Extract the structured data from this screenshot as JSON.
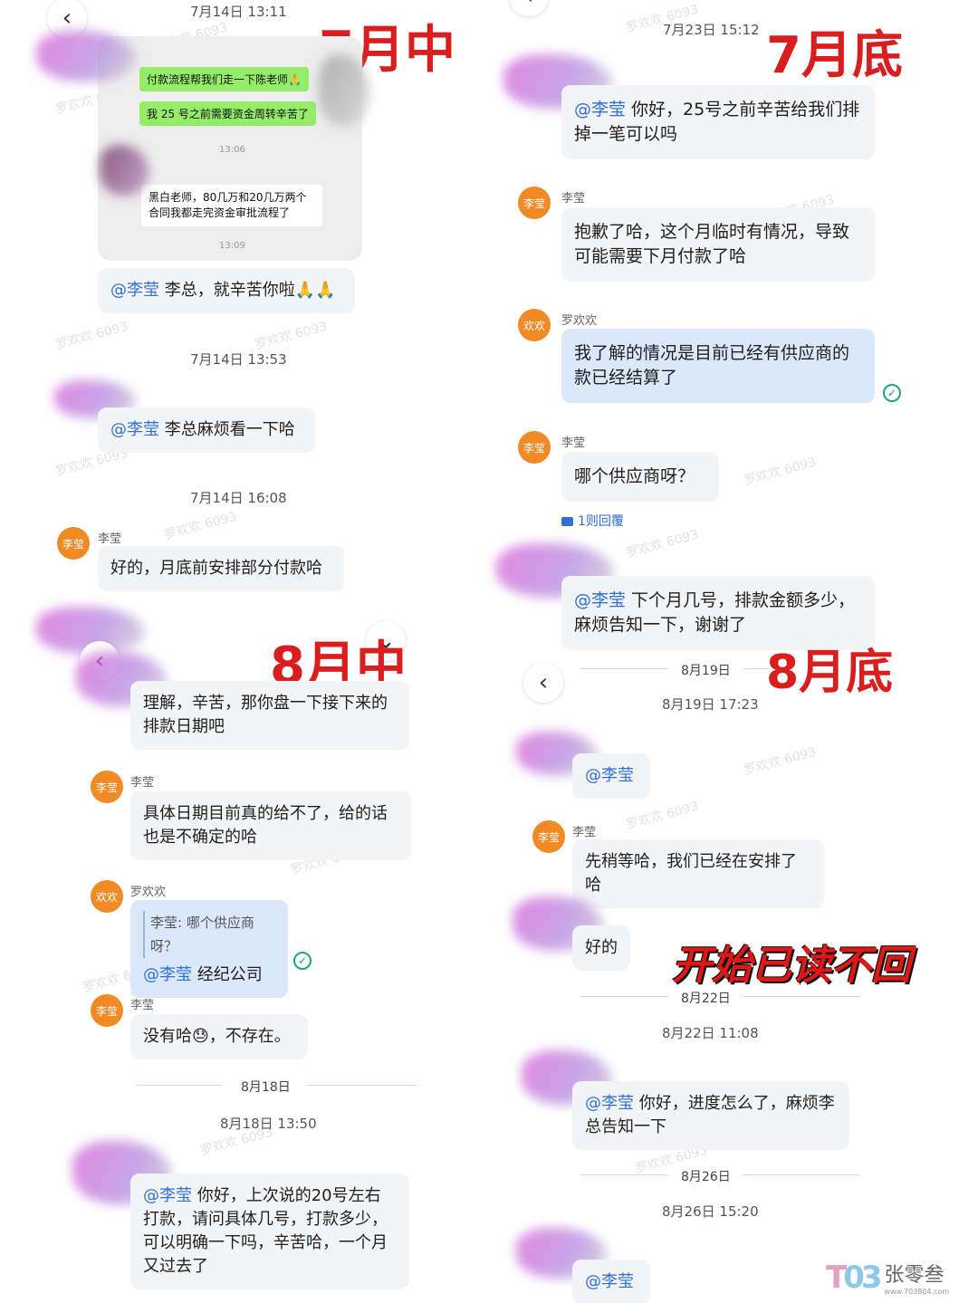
{
  "labels": {
    "july_mid": "7月中",
    "july_end": "7月底",
    "aug_mid": "8月中",
    "aug_end": "8月底",
    "read_no_reply": "开始已读不回"
  },
  "left": {
    "ts1": "7月14日 13:11",
    "embedded": {
      "msg1": "付款流程帮我们走一下陈老师🙏",
      "msg2": "我 25 号之前需要资金周转辛苦了",
      "time1": "13:06",
      "msg3": "黑白老师，80几万和20几万两个合同我都走完资金审批流程了",
      "time2": "13:09"
    },
    "m1_mention": "@李莹",
    "m1_text": " 李总，就辛苦你啦🙏🙏",
    "ts2": "7月14日 13:53",
    "m2_mention": "@李莹",
    "m2_text": " 李总麻烦看一下哈",
    "ts3": "7月14日 16:08",
    "avatar_liying": "李莹",
    "sender_liying": "李莹",
    "m3_text": "好的，月底前安排部分付款哈",
    "m4_text": "理解，辛苦，那你盘一下接下来的排款日期吧",
    "m5_text": "具体日期目前真的给不了，给的话也是不确定的哈",
    "avatar_huan": "欢欢",
    "sender_huan": "罗欢欢",
    "m6_quote": "李莹: 哪个供应商呀？",
    "m6_mention": "@李莹",
    "m6_text": " 经纪公司",
    "m7_text": "没有哈😓，不存在。",
    "date_aug18": "8月18日",
    "ts4": "8月18日 13:50",
    "m8_mention": "@李莹",
    "m8_text": " 你好，上次说的20号左右打款，请问具体几号，打款多少，可以明确一下吗，辛苦哈，一个月又过去了"
  },
  "right": {
    "ts1": "7月23日 15:12",
    "r1_mention": "@李莹",
    "r1_text": " 你好，25号之前辛苦给我们排掉一笔可以吗",
    "avatar_liying": "李莹",
    "sender_liying": "李莹",
    "r2_text": "抱歉了哈，这个月临时有情况，导致可能需要下月付款了哈",
    "avatar_huan": "欢欢",
    "sender_huan": "罗欢欢",
    "r3_text": "我了解的情况是目前已经有供应商的款已经结算了",
    "r4_text": "哪个供应商呀？",
    "reply_count": "1则回覆",
    "r5_mention": "@李莹",
    "r5_text": " 下个月几号，排款金额多少，麻烦告知一下，谢谢了",
    "date_aug19": "8月19日",
    "ts2": "8月19日 17:23",
    "r6_mention": "@李莹",
    "r7_text": "先稍等哈，我们已经在安排了哈",
    "r8_text": "好的",
    "date_aug22": "8月22日",
    "ts3": "8月22日 11:08",
    "r9_mention": "@李莹",
    "r9_text": " 你好，进度怎么了，麻烦李总告知一下",
    "date_aug26": "8月26日",
    "ts4": "8月26日 15:20",
    "r10_mention": "@李莹"
  },
  "watermark": "罗欢欢 6093",
  "logo": {
    "brand": "张零叁",
    "url": "www.703804.com"
  }
}
